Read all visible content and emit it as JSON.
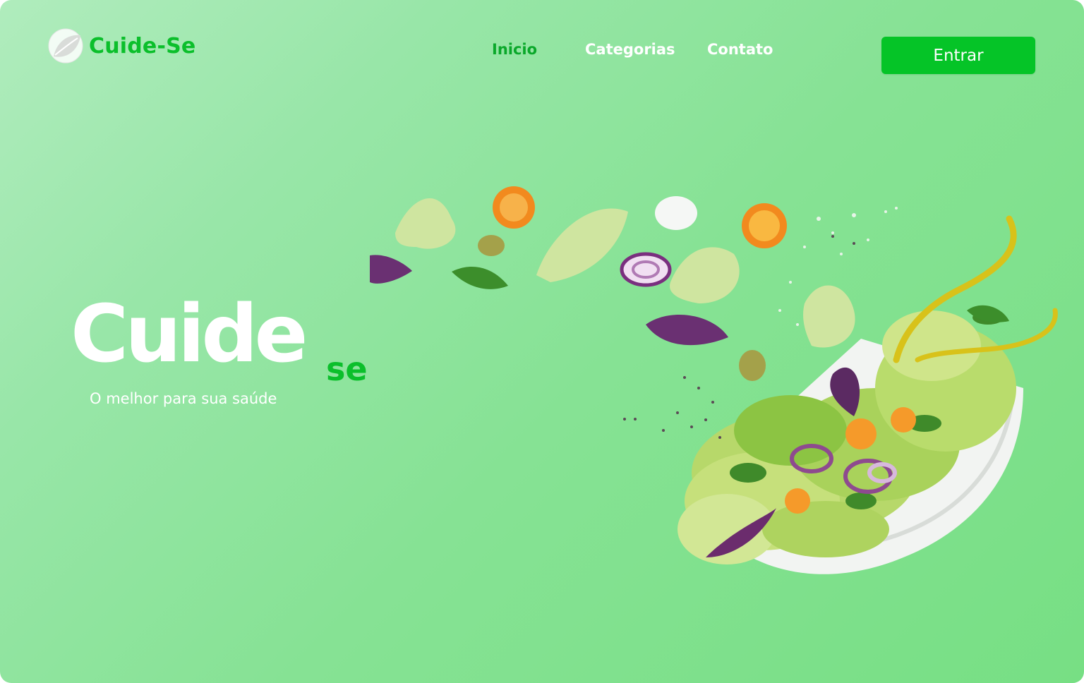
{
  "header": {
    "logo_text": "Cuide-Se",
    "logo_icon": "leaf-icon",
    "nav": [
      {
        "label": "Inicio",
        "active": true
      },
      {
        "label": "Categorias",
        "active": false
      },
      {
        "label": "Contato",
        "active": false
      }
    ],
    "login_label": "Entrar"
  },
  "hero": {
    "title": "Cuide",
    "title_suffix": "se",
    "tagline": "O melhor para sua saúde",
    "image": "salad-bowl-image"
  },
  "colors": {
    "brand_green": "#0bbf2b",
    "button_green": "#05c427",
    "active_nav": "#0aa82a",
    "background_light": "#b0ecbd",
    "background_dark": "#77df84"
  }
}
